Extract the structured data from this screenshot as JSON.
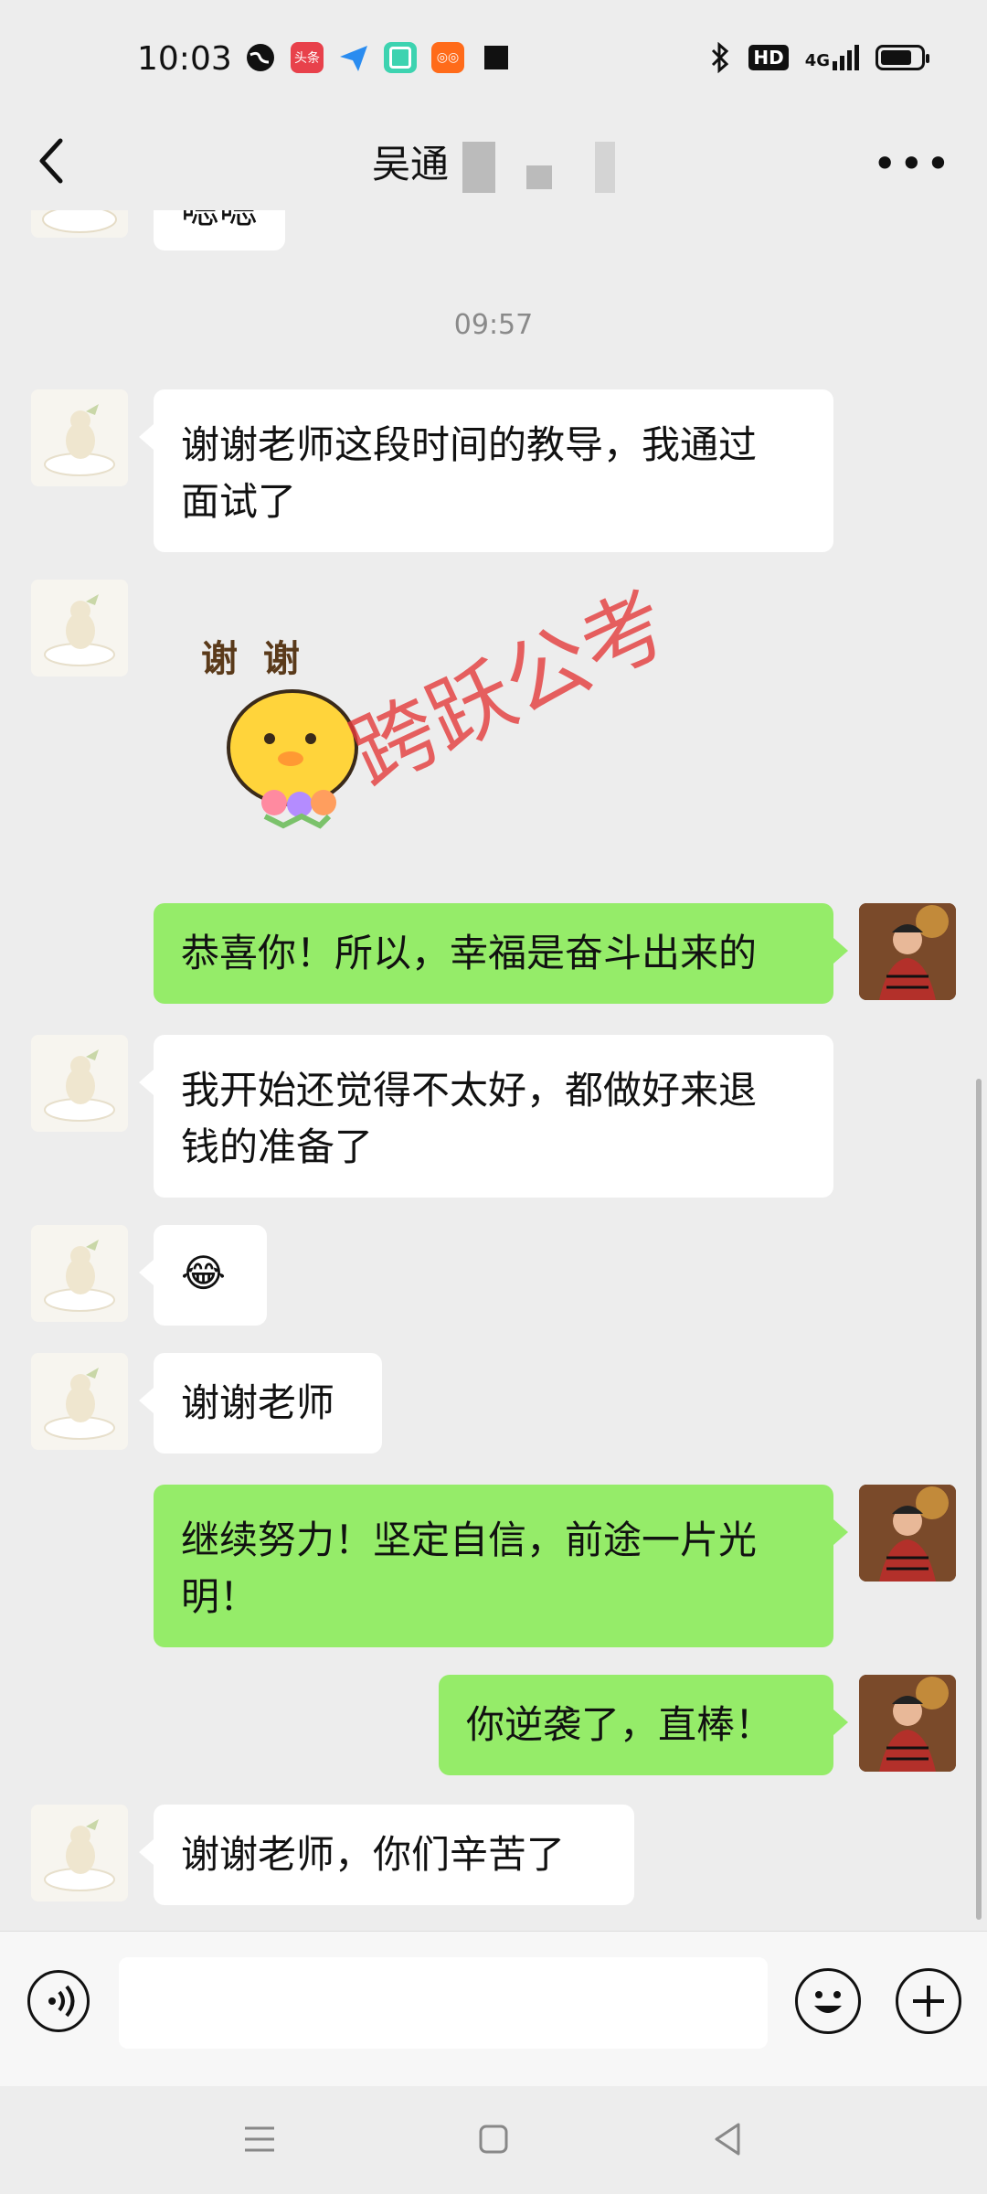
{
  "status_bar": {
    "time": "10:03",
    "app_icons": [
      "globe-icon",
      "toutiao-icon",
      "paper-plane-icon",
      "chat-app-icon",
      "kuaishou-icon",
      "square-icon"
    ],
    "right_text": "HD",
    "network": "4G",
    "battery_level": 0.68
  },
  "header": {
    "title": "吴通"
  },
  "chat": {
    "timestamp": "09:57",
    "top_partial_message": "嗯嗯",
    "watermark": "跨跃公考",
    "messages": [
      {
        "side": "left",
        "type": "text",
        "text": "谢谢老师这段时间的教导，我通过\n面试了"
      },
      {
        "side": "left",
        "type": "sticker",
        "text": "谢  谢"
      },
      {
        "side": "right",
        "type": "text",
        "text": "恭喜你！所以，幸福是奋斗出来的"
      },
      {
        "side": "left",
        "type": "text",
        "text": "我开始还觉得不太好，都做好来退\n钱的准备了"
      },
      {
        "side": "left",
        "type": "emoji",
        "text": "😂"
      },
      {
        "side": "left",
        "type": "text",
        "text": "谢谢老师"
      },
      {
        "side": "right",
        "type": "text",
        "text": "继续努力！坚定自信，前途一片光\n明！"
      },
      {
        "side": "right",
        "type": "text",
        "text": "你逆袭了，直棒！"
      },
      {
        "side": "left",
        "type": "text",
        "text": "谢谢老师，你们辛苦了"
      }
    ]
  },
  "input_bar": {
    "placeholder": ""
  },
  "colors": {
    "background": "#ededed",
    "incoming_bubble": "#ffffff",
    "outgoing_bubble": "#95ec69",
    "watermark": "#e43b3b"
  }
}
